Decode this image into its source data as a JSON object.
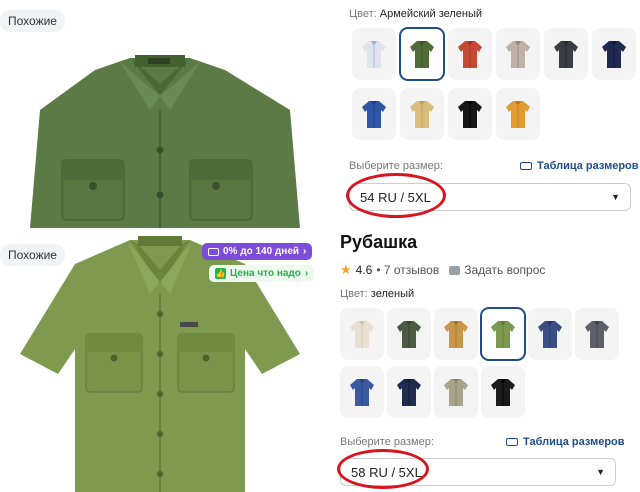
{
  "similar_label": "Похожие",
  "top": {
    "color_label": "Цвет:",
    "color_value": "Армейский зеленый",
    "size_prompt": "Выберите размер:",
    "size_table": "Таблица размеров",
    "size_value": "54 RU / 5XL",
    "swatches": [
      {
        "color": "#dfe3ee",
        "accent": "#9fb0d6"
      },
      {
        "color": "#4f6b38",
        "accent": "#3a5228",
        "selected": true
      },
      {
        "color": "#c44a36",
        "accent": "#9c3324"
      },
      {
        "color": "#bfb1a4",
        "accent": "#978676"
      },
      {
        "color": "#3b3d44",
        "accent": "#25272c"
      },
      {
        "color": "#1e2a52",
        "accent": "#121a38"
      },
      {
        "color": "#2f57a8",
        "accent": "#1f3f80"
      },
      {
        "color": "#d8bd7c",
        "accent": "#b89e5e"
      },
      {
        "color": "#161616",
        "accent": "#000000"
      },
      {
        "color": "#e19b32",
        "accent": "#b97a1d"
      }
    ]
  },
  "product": {
    "title": "Рубашка",
    "rating": "4.6",
    "reviews": "• 7 отзывов",
    "ask": "Задать вопрос",
    "color_label": "Цвет:",
    "color_value": "зеленый",
    "size_prompt": "Выберите размер:",
    "size_table": "Таблица размеров",
    "size_value": "58 RU / 5XL",
    "badge_installment": "0% до 140 дней",
    "badge_price": "Цена что надо",
    "swatches": [
      {
        "color": "#e8e1d2",
        "accent": "#cfc4ac"
      },
      {
        "color": "#4d5b43",
        "accent": "#384430"
      },
      {
        "color": "#c8974a",
        "accent": "#a57734"
      },
      {
        "color": "#7b9a4f",
        "accent": "#5f7d38",
        "selected": true
      },
      {
        "color": "#3a4f86",
        "accent": "#263865"
      },
      {
        "color": "#5d6068",
        "accent": "#41444b"
      },
      {
        "color": "#3a59a3",
        "accent": "#283f7b"
      },
      {
        "color": "#1f2c4d",
        "accent": "#121b33"
      },
      {
        "color": "#a7a48a",
        "accent": "#85826a"
      },
      {
        "color": "#1a1a1a",
        "accent": "#000000"
      }
    ]
  },
  "colors": {
    "accent": "#1f4d8c",
    "highlight": "#d9141e",
    "badge_purple": "#7d4cdb",
    "badge_green": "#27b34a",
    "star": "#f5a623"
  }
}
